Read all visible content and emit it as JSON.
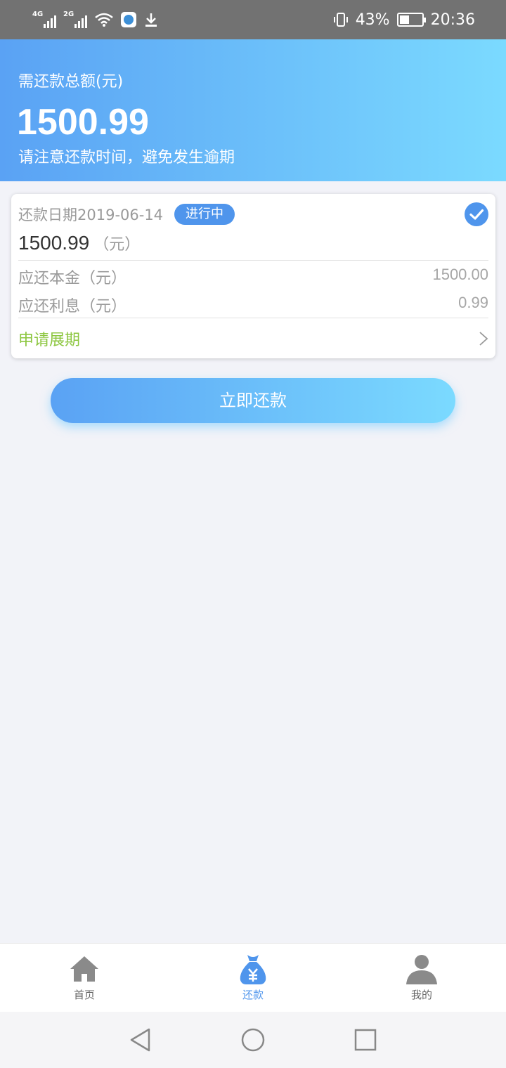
{
  "status_bar": {
    "network1": "4G",
    "network2": "2G",
    "battery_percent": "43%",
    "battery_level": 0.43,
    "time": "20:36",
    "icons": [
      "signal-icon",
      "signal-icon",
      "wifi-icon",
      "app-notification-icon",
      "download-icon",
      "vibrate-icon",
      "battery-icon"
    ]
  },
  "header": {
    "label": "需还款总额(元)",
    "amount": "1500.99",
    "note": "请注意还款时间，避免发生逾期"
  },
  "card": {
    "date_label": "还款日期2019-06-14",
    "status_badge": "进行中",
    "amount": "1500.99",
    "amount_unit": "（元）",
    "principal_label": "应还本金（元）",
    "principal_value": "1500.00",
    "interest_label": "应还利息（元）",
    "interest_value": "0.99",
    "extend_label": "申请展期",
    "check_selected": true
  },
  "pay_button": {
    "label": "立即还款"
  },
  "tab_bar": {
    "tabs": [
      {
        "label": "首页",
        "icon": "home-icon",
        "active": false
      },
      {
        "label": "还款",
        "icon": "money-bag-icon",
        "active": true
      },
      {
        "label": "我的",
        "icon": "user-icon",
        "active": false
      }
    ]
  },
  "colors": {
    "gradient_start": "#5aa2f4",
    "gradient_end": "#7bdaff",
    "accent_blue": "#4f95ec",
    "extend_green": "#8cc63f"
  }
}
